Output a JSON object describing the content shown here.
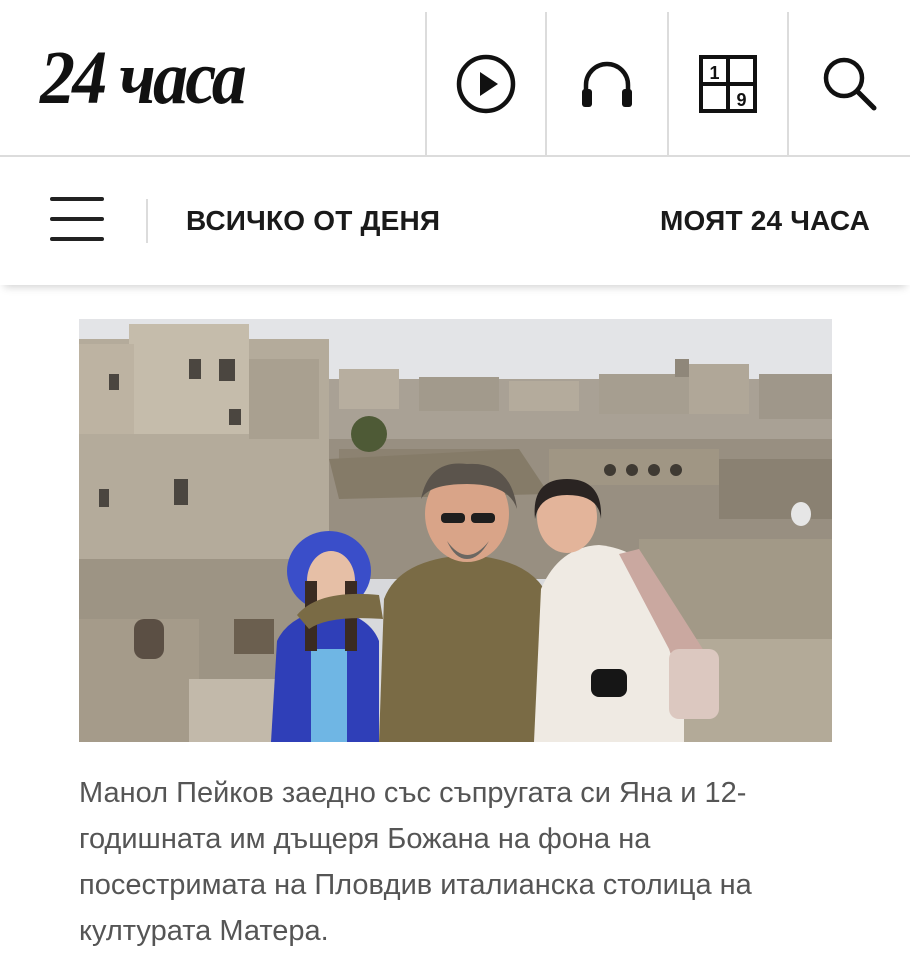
{
  "header": {
    "logo_text": "24 часа",
    "icons": [
      "play-circle-icon",
      "headphones-icon",
      "sudoku-icon",
      "search-icon"
    ],
    "sudoku_digits": [
      "1",
      "9"
    ]
  },
  "nav": {
    "all_today": "ВСИЧКО ОТ ДЕНЯ",
    "my_24": "МОЯТ 24 ЧАСА"
  },
  "article": {
    "caption": "Манол Пейков заедно със съпругата си Яна и 12-годишната им дъщеря Божана на фона на посестримата на Пловдив италианска столица на културата Матера."
  },
  "colors": {
    "text": "#111111",
    "caption": "#555555",
    "divider": "#dcdcdc"
  }
}
